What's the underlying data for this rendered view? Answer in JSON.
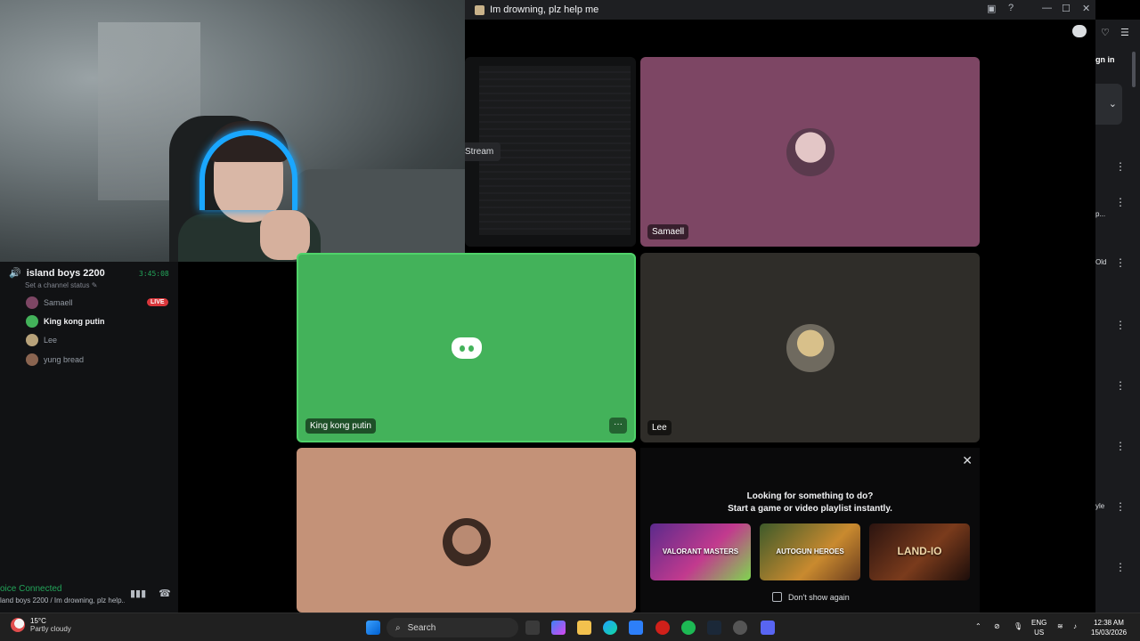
{
  "window": {
    "title": "Im drowning, plz help me"
  },
  "sidebar": {
    "channel_name": "island boys 2200",
    "timer": "3:45:08",
    "status_placeholder": "Set a channel status",
    "members": [
      {
        "name": "Samaell",
        "live": true
      },
      {
        "name": "King kong putin",
        "live": false
      },
      {
        "name": "Lee",
        "live": false
      },
      {
        "name": "yung bread",
        "live": false
      }
    ],
    "live_badge": "LIVE",
    "voice_connected": "oice Connected",
    "voice_channel": "land boys 2200 / Im drowning, plz help..."
  },
  "tiles": {
    "stream_label": "Stream",
    "samaell": "Samaell",
    "kingkong": "King kong putin",
    "lee": "Lee",
    "more": "···"
  },
  "activity": {
    "line1": "Looking for something to do?",
    "line2": "Start a game or video playlist instantly.",
    "cards": [
      "VALORANT MASTERS",
      "AUTOGUN HEROES",
      "LAND-IO"
    ],
    "dont_show": "Don't show again"
  },
  "right_panel": {
    "sign_in": "gn in",
    "snippets": [
      "p...",
      "Old",
      "yle"
    ]
  },
  "taskbar": {
    "temp": "15°C",
    "weather": "Partly cloudy",
    "search": "Search",
    "lang1": "ENG",
    "lang2": "US",
    "time": "12:38 AM",
    "date": "15/03/2026"
  },
  "colors": {
    "accent_green": "#23a55a",
    "speaking_green": "#43b25a",
    "live_red": "#da373c"
  }
}
